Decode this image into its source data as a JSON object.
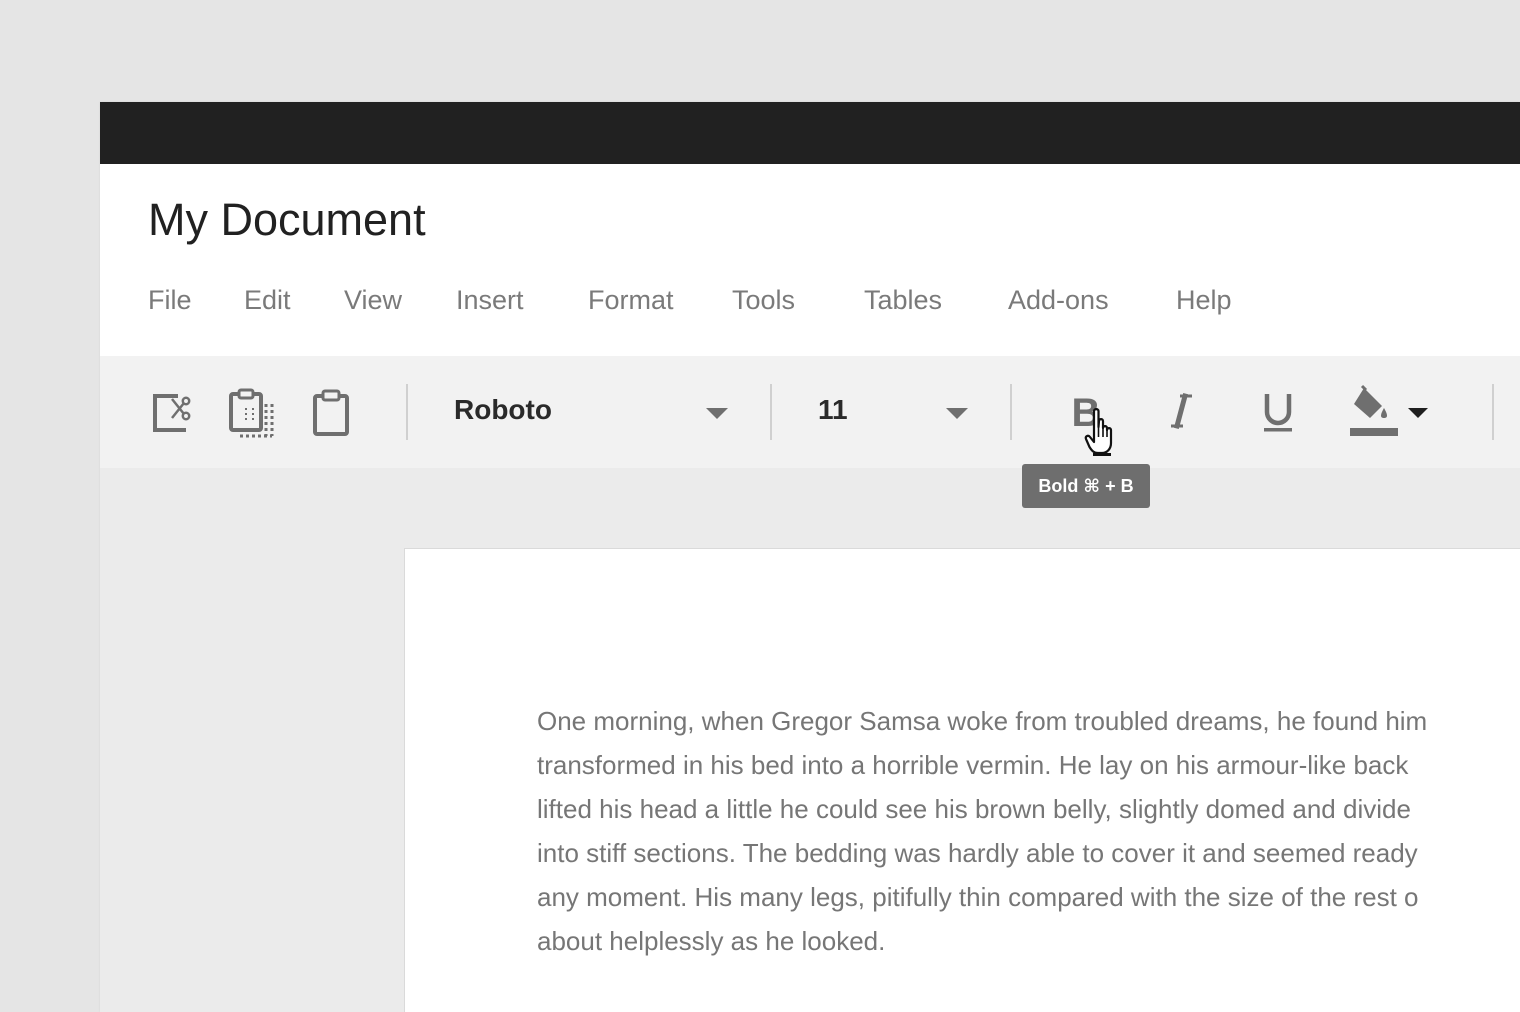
{
  "document": {
    "title": "My Document"
  },
  "menu": {
    "items": [
      {
        "label": "File"
      },
      {
        "label": "Edit"
      },
      {
        "label": "View"
      },
      {
        "label": "Insert"
      },
      {
        "label": "Format"
      },
      {
        "label": "Tools"
      },
      {
        "label": "Tables"
      },
      {
        "label": "Add-ons"
      },
      {
        "label": "Help"
      }
    ]
  },
  "toolbar": {
    "clipboard_icons": [
      "cut-icon",
      "copy-icon",
      "paste-icon"
    ],
    "font_family": "Roboto",
    "font_size": "11",
    "format_icons": [
      "bold-icon",
      "italic-icon",
      "underline-icon",
      "fill-color-icon"
    ],
    "bold_tooltip": "Bold ⌘ + B"
  },
  "body": {
    "lines": [
      "One morning, when Gregor Samsa woke from troubled dreams, he found him",
      "transformed in his bed into a horrible vermin. He lay on his armour-like back",
      "lifted his head a little he could see his brown belly, slightly domed and divide",
      "into stiff sections. The bedding was hardly able to cover it and seemed ready",
      "any moment. His many legs, pitifully thin compared with the size of the rest o",
      "about helplessly as he looked."
    ]
  },
  "colors": {
    "titlebar": "#212121",
    "icon": "#6f6f6f",
    "fill_color_swatch": "#6f6f6f",
    "tooltip_bg": "#6e6e6e"
  }
}
